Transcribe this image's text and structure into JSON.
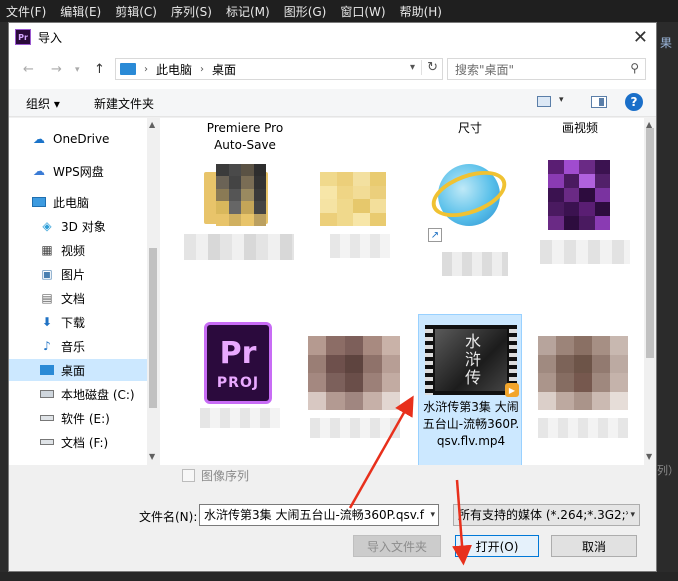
{
  "menubar": {
    "items": [
      "文件(F)",
      "编辑(E)",
      "剪辑(C)",
      "序列(S)",
      "标记(M)",
      "图形(G)",
      "窗口(W)",
      "帮助(H)"
    ],
    "right_text": "果",
    "right_text2": "列）"
  },
  "dialog": {
    "title": "导入",
    "close_label": "✕"
  },
  "address": {
    "crumbs": [
      "此电脑",
      "桌面"
    ],
    "search_placeholder": "搜索\"桌面\""
  },
  "toolbar": {
    "organize_label": "组织 ▾",
    "new_folder_label": "新建文件夹"
  },
  "nav": {
    "items": [
      {
        "label": "OneDrive",
        "icon": "cloud-icon"
      },
      {
        "label": "WPS网盘",
        "icon": "cloud-outline-icon"
      },
      {
        "label": "此电脑",
        "icon": "computer-icon"
      },
      {
        "label": "3D 对象",
        "icon": "cube-icon"
      },
      {
        "label": "视频",
        "icon": "film-icon"
      },
      {
        "label": "图片",
        "icon": "image-icon"
      },
      {
        "label": "文档",
        "icon": "document-icon"
      },
      {
        "label": "下载",
        "icon": "download-icon"
      },
      {
        "label": "音乐",
        "icon": "music-icon"
      },
      {
        "label": "桌面",
        "icon": "desktop-icon",
        "selected": true
      },
      {
        "label": "本地磁盘 (C:)",
        "icon": "drive-icon"
      },
      {
        "label": "软件 (E:)",
        "icon": "drive-icon"
      },
      {
        "label": "文档 (F:)",
        "icon": "drive-icon"
      }
    ]
  },
  "files": {
    "top_labels": {
      "premiere_autosave": "Premiere Pro\nAuto-Save",
      "chicun": "尺寸",
      "huashipin": "画视频"
    },
    "pr_proj_text": "Pr",
    "pr_proj_sub": "PROJ",
    "pr_icon_text": "Pr",
    "selected_name": "水浒传第3集 大闹五台山-流畅360P.qsv.flv.mp4",
    "thumb_text": "水浒传"
  },
  "bottom": {
    "image_sequence_label": "图像序列",
    "filename_label": "文件名(N):",
    "filename_value": "水浒传第3集 大闹五台山-流畅360P.qsv.f",
    "filetype_value": "所有支持的媒体 (*.264;*.3G2;*",
    "import_folder_label": "导入文件夹",
    "open_label": "打开(O)",
    "cancel_label": "取消"
  },
  "colors": {
    "accent": "#0078d7",
    "selection": "#cce8ff",
    "arrow": "#e8301c",
    "premiere_purple": "#c86cf5"
  }
}
